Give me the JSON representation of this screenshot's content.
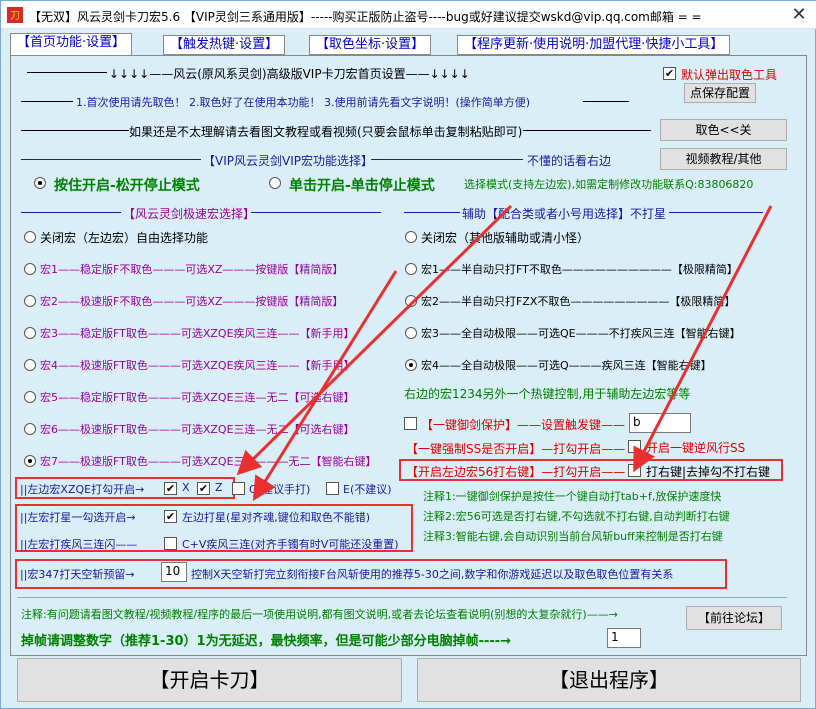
{
  "window": {
    "title": "【无双】风云灵剑卡刀宏5.6 【VIP灵剑三系通用版】-----购买正版防止盗号----bug或好建议提交wskd@vip.qq.com邮箱 = =",
    "close_glyph": "✕"
  },
  "tabs": [
    {
      "label": "【首页功能·设置】"
    },
    {
      "label": "【触发热键·设置】"
    },
    {
      "label": "【取色坐标·设置】"
    },
    {
      "label": "【程序更新·使用说明·加盟代理·快捷小工具】"
    }
  ],
  "header": {
    "line1": "↓↓↓↓——风云(原风系灵剑)高级版VIP卡刀宏首页设置——↓↓↓↓",
    "line2": "1.首次使用请先取色！ 2.取色好了在使用本功能！  3.使用前请先看文字说明！(操作简单方便)",
    "line3": "如果还是不太理解请去看图文教程或看视频(只要会鼠标单击复制粘贴即可)",
    "line4": "【VIP风云灵剑VIP宏功能选择】",
    "line4_right": "不懂的话看右边"
  },
  "right_tools": {
    "default_popup_label": "默认弹出取色工具",
    "default_popup_checked": true,
    "save_config_btn": "点保存配置",
    "pick_color_btn": "取色<<关",
    "video_tutorial_btn": "视频教程/其他"
  },
  "modes": {
    "hold_label": "按住开启-松开停止模式",
    "toggle_label": "单击开启-单击停止模式",
    "selected": "hold",
    "note": "选择模式(支持左边宏),如需定制修改功能联系Q:83806820"
  },
  "left_group": {
    "title": "【风云灵剑极速宏选择】",
    "options": [
      {
        "label": "关闭宏（左边宏）自由选择功能",
        "selected": false
      },
      {
        "label": "宏1——稳定版F不取色———可选XZ———按键版【精简版】",
        "selected": false
      },
      {
        "label": "宏2——极速版F不取色———可选XZ———按键版【精简版】",
        "selected": false
      },
      {
        "label": "宏3——稳定版FT取色———可选XZQE疾风三连——【新手用】",
        "selected": false
      },
      {
        "label": "宏4——极速版FT取色———可选XZQE疾风三连——【新手用】",
        "selected": false
      },
      {
        "label": "宏5——稳定版FT取色———可选XZQE三连—无二【可选右键】",
        "selected": false
      },
      {
        "label": "宏6——极速版FT取色———可选XZQE三连—无二【可选右键】",
        "selected": false
      },
      {
        "label": "宏7——极速版FT取色———可选XZQE三连———无二【智能右键】",
        "selected": true
      }
    ]
  },
  "right_group": {
    "title": "辅助【配合类或者小号用选择】不打星",
    "options": [
      {
        "label": "关闭宏（其他版辅助或清小怪）",
        "selected": false
      },
      {
        "label": "宏1——半自动只打FT不取色——————————【极限精简】",
        "selected": false
      },
      {
        "label": "宏2——半自动只打FZX不取色—————————【极限精简】",
        "selected": false
      },
      {
        "label": "宏3——全自动极限——可选QE———不打疾风三连【智能右键】",
        "selected": false
      },
      {
        "label": "宏4——全自动极限——可选Q———疾风三连【智能右键】",
        "selected": true
      }
    ],
    "hotkey_note": "右边的宏1234另外一个热键控制,用于辅助左边宏等等"
  },
  "left_options": {
    "xz_label": "||左边宏XZQE打勾开启→",
    "x_label": "X",
    "x_checked": true,
    "z_label": "Z",
    "z_checked": true,
    "q_label": "Q(建议手打)",
    "q_checked": false,
    "e_label": "E(不建议)",
    "e_checked": false,
    "star_prefix": "||左宏打星一勾选开启→",
    "star_label": "左边打星(星对齐魂,键位和取色不能错)",
    "star_checked": true,
    "gale_prefix": "||左宏打疾风三连闪——",
    "gale_label": "C+V疾风三连(对齐手镯有时V可能还没重置)",
    "gale_checked": false,
    "sky_prefix": "||宏347打天空斩预留→",
    "sky_value": "10",
    "sky_note": "控制X天空斩打完立刻衔接F台风斩使用的推荐5-30之间,数字和你游戏延迟以及取色取色位置有关系"
  },
  "right_options": {
    "guard_label": "【一键御剑保护】——设置触发键——",
    "guard_checked": false,
    "guard_key": "b",
    "force_ss_label": "【一键强制SS是否开启】—打勾开启——",
    "force_ss_check_label": "开启一键逆风行SS",
    "force_ss_checked": false,
    "left56_label": "【开启左边宏56打右键】—打勾开启——",
    "left56_check_label": "打右键|去掉勾不打右键",
    "left56_checked": false,
    "note1": "注释1:一键御剑保护是按住一个键自动打tab+f,放保护速度快",
    "note2": "注释2:宏56可选是否打右键,不勾选就不打右键,自动判断打右键",
    "note3": "注释3:智能右键,会自动识别当前台风斩buff来控制是否打右键"
  },
  "footer": {
    "note": "注释:有问题请看图文教程/视频教程/程序的最后一项使用说明,都有图文说明,或者去论坛查看说明(别想的太复杂就行)——→",
    "forum_btn": "【前往论坛】",
    "frame_label": "掉帧请调整数字（推荐1-30）1为无延迟，最快频率，但是可能少部分电脑掉帧----→",
    "frame_value": "1",
    "start_btn": "【开启卡刀】",
    "exit_btn": "【退出程序】"
  }
}
